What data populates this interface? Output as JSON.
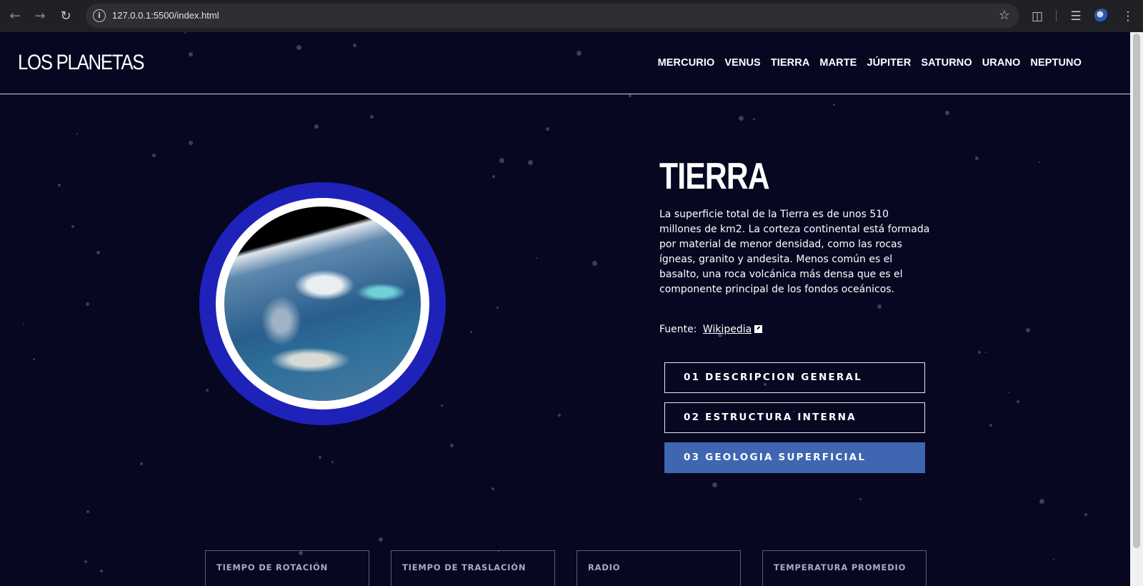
{
  "browser": {
    "url": "127.0.0.1:5500/index.html"
  },
  "site": {
    "logo": "LOS PLANETAS",
    "nav": [
      "MERCURIO",
      "VENUS",
      "TIERRA",
      "MARTE",
      "JÚPITER",
      "SATURNO",
      "URANO",
      "NEPTUNO"
    ]
  },
  "planet": {
    "name": "TIERRA",
    "description": "La superficie total de la Tierra es de unos 510 millones de km2. La corteza continental está formada por material de menor densidad, como las rocas ígneas, granito y andesita. Menos común es el basalto, una roca volcánica más densa que es el componente principal de los fondos oceánicos.",
    "source_label": "Fuente:",
    "source_link": "Wikipedia",
    "tabs": [
      "01 DESCRIPCION GENERAL",
      "02 ESTRUCTURA INTERNA",
      "03 GEOLOGIA SUPERFICIAL"
    ],
    "active_tab": 2,
    "stats": [
      "TIEMPO DE ROTACIÓN",
      "TIEMPO DE TRASLACIÓN",
      "RADIO",
      "TEMPERATURA PROMEDIO"
    ]
  },
  "colors": {
    "background": "#070722",
    "ring": "#1e22b8",
    "active_tab": "#3f66b1"
  },
  "icons": [
    "back-icon",
    "forward-icon",
    "reload-icon",
    "info-icon",
    "star-icon",
    "extensions-icon",
    "media-icon",
    "menu-icon",
    "external-link-icon"
  ]
}
